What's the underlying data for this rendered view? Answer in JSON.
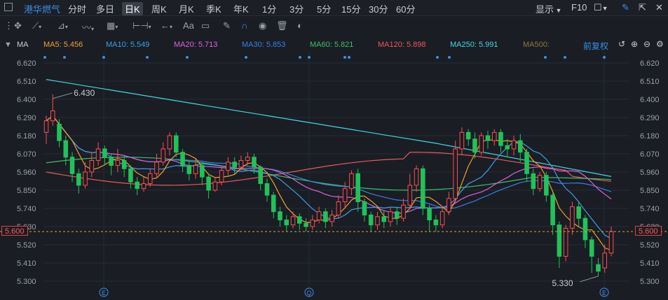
{
  "header": {
    "stock_name": "港华燃气",
    "timeframes": [
      "分时",
      "多日",
      "日K",
      "周K",
      "月K",
      "季K",
      "年K",
      "1分",
      "3分",
      "5分",
      "15分",
      "30分",
      "60分"
    ],
    "active_timeframe": "日K",
    "show_label": "显示",
    "f10_label": "F10"
  },
  "toolbar": {
    "font_label": "Aa"
  },
  "ma_bar": {
    "label": "MA",
    "items": [
      {
        "text": "MA5: 5.456",
        "color": "#f0a030"
      },
      {
        "text": "MA10: 5.549",
        "color": "#3aa0e8"
      },
      {
        "text": "MA20: 5.713",
        "color": "#e060e0"
      },
      {
        "text": "MA30: 5.853",
        "color": "#3a7ee6"
      },
      {
        "text": "MA60: 5.821",
        "color": "#3cc06a"
      },
      {
        "text": "MA120: 5.898",
        "color": "#e85a5a"
      },
      {
        "text": "MA250: 5.991",
        "color": "#40d8e0"
      },
      {
        "text": "MA500:",
        "color": "#8a7a40"
      }
    ],
    "adjust_label": "前复权"
  },
  "axis": {
    "ticks": [
      "6.620",
      "6.510",
      "6.400",
      "6.290",
      "6.180",
      "6.070",
      "5.960",
      "5.850",
      "5.740",
      "5.630",
      "5.520",
      "5.410",
      "5.300"
    ],
    "current_price": "5.600"
  },
  "annotations": {
    "high": "6.430",
    "low": "5.330"
  },
  "markers": {
    "e1": "E",
    "q": "Q",
    "e2": "E"
  },
  "colors": {
    "up": "#ff4d4f",
    "down": "#21c25a",
    "background": "#1a1d24",
    "accent": "#3a8ee6"
  },
  "chart_data": {
    "type": "candlestick",
    "y_range": [
      5.25,
      6.66
    ],
    "candles": [
      [
        6.2,
        6.27,
        6.13,
        6.3
      ],
      [
        6.27,
        6.33,
        6.24,
        6.43
      ],
      [
        6.25,
        6.15,
        6.11,
        6.28
      ],
      [
        6.15,
        6.05,
        6.0,
        6.18
      ],
      [
        6.05,
        5.95,
        5.9,
        6.08
      ],
      [
        5.95,
        5.88,
        5.83,
        5.98
      ],
      [
        5.88,
        5.96,
        5.86,
        6.02
      ],
      [
        5.96,
        6.03,
        5.93,
        6.08
      ],
      [
        6.03,
        6.1,
        6.0,
        6.14
      ],
      [
        6.1,
        6.05,
        6.0,
        6.12
      ],
      [
        6.05,
        6.0,
        5.94,
        6.07
      ],
      [
        6.0,
        6.03,
        5.96,
        6.1
      ],
      [
        6.03,
        5.98,
        5.93,
        6.06
      ],
      [
        5.98,
        5.9,
        5.86,
        6.0
      ],
      [
        5.9,
        5.86,
        5.82,
        5.93
      ],
      [
        5.86,
        5.89,
        5.84,
        5.93
      ],
      [
        5.89,
        5.95,
        5.87,
        5.98
      ],
      [
        5.95,
        6.02,
        5.93,
        6.07
      ],
      [
        6.02,
        6.1,
        6.0,
        6.14
      ],
      [
        6.1,
        6.18,
        6.06,
        6.2
      ],
      [
        6.18,
        6.08,
        6.05,
        6.2
      ],
      [
        6.08,
        6.0,
        5.96,
        6.1
      ],
      [
        6.0,
        5.95,
        5.91,
        6.03
      ],
      [
        5.95,
        6.0,
        5.92,
        6.04
      ],
      [
        6.0,
        5.93,
        5.88,
        6.02
      ],
      [
        5.93,
        5.85,
        5.8,
        5.95
      ],
      [
        5.85,
        5.9,
        5.84,
        5.93
      ],
      [
        5.9,
        5.97,
        5.88,
        6.0
      ],
      [
        5.97,
        6.02,
        5.94,
        6.05
      ],
      [
        6.02,
        5.99,
        5.95,
        6.05
      ],
      [
        5.99,
        6.03,
        5.97,
        6.06
      ],
      [
        6.03,
        6.05,
        6.0,
        6.08
      ],
      [
        6.05,
        5.99,
        5.95,
        6.07
      ],
      [
        5.99,
        5.89,
        5.85,
        6.0
      ],
      [
        5.89,
        5.82,
        5.78,
        5.92
      ],
      [
        5.82,
        5.72,
        5.68,
        5.84
      ],
      [
        5.72,
        5.67,
        5.63,
        5.75
      ],
      [
        5.67,
        5.64,
        5.6,
        5.7
      ],
      [
        5.64,
        5.69,
        5.62,
        5.72
      ],
      [
        5.69,
        5.65,
        5.61,
        5.71
      ],
      [
        5.65,
        5.63,
        5.6,
        5.68
      ],
      [
        5.63,
        5.67,
        5.61,
        5.7
      ],
      [
        5.67,
        5.72,
        5.65,
        5.75
      ],
      [
        5.72,
        5.66,
        5.62,
        5.74
      ],
      [
        5.66,
        5.7,
        5.63,
        5.73
      ],
      [
        5.7,
        5.78,
        5.68,
        5.82
      ],
      [
        5.78,
        5.86,
        5.75,
        5.9
      ],
      [
        5.86,
        5.95,
        5.82,
        5.97
      ],
      [
        5.95,
        5.78,
        5.72,
        5.98
      ],
      [
        5.78,
        5.7,
        5.66,
        5.8
      ],
      [
        5.7,
        5.64,
        5.6,
        5.72
      ],
      [
        5.64,
        5.69,
        5.61,
        5.72
      ],
      [
        5.69,
        5.66,
        5.62,
        5.73
      ],
      [
        5.66,
        5.72,
        5.63,
        5.75
      ],
      [
        5.72,
        5.68,
        5.64,
        5.75
      ],
      [
        5.68,
        5.76,
        5.66,
        5.8
      ],
      [
        5.76,
        5.88,
        5.74,
        5.95
      ],
      [
        5.88,
        5.98,
        5.84,
        6.0
      ],
      [
        5.98,
        5.74,
        5.7,
        6.0
      ],
      [
        5.74,
        5.67,
        5.6,
        5.76
      ],
      [
        5.67,
        5.64,
        5.6,
        5.7
      ],
      [
        5.64,
        5.72,
        5.62,
        5.75
      ],
      [
        5.72,
        5.8,
        5.7,
        5.84
      ],
      [
        5.8,
        6.1,
        5.78,
        6.15
      ],
      [
        6.1,
        6.2,
        6.06,
        6.23
      ],
      [
        6.2,
        6.16,
        6.12,
        6.22
      ],
      [
        6.16,
        6.08,
        6.04,
        6.2
      ],
      [
        6.08,
        6.18,
        6.06,
        6.2
      ],
      [
        6.18,
        6.15,
        6.1,
        6.21
      ],
      [
        6.15,
        6.2,
        6.12,
        6.22
      ],
      [
        6.2,
        6.12,
        6.08,
        6.22
      ],
      [
        6.12,
        6.1,
        6.05,
        6.16
      ],
      [
        6.1,
        6.15,
        6.06,
        6.18
      ],
      [
        6.15,
        6.08,
        6.02,
        6.19
      ],
      [
        6.08,
        5.95,
        5.9,
        6.1
      ],
      [
        5.95,
        5.86,
        5.82,
        5.98
      ],
      [
        5.86,
        5.94,
        5.84,
        5.96
      ],
      [
        5.94,
        5.82,
        5.78,
        5.96
      ],
      [
        5.82,
        5.64,
        5.58,
        5.84
      ],
      [
        5.64,
        5.45,
        5.38,
        5.66
      ],
      [
        5.45,
        5.62,
        5.42,
        5.64
      ],
      [
        5.62,
        5.75,
        5.58,
        5.78
      ],
      [
        5.75,
        5.68,
        5.63,
        5.78
      ],
      [
        5.68,
        5.55,
        5.5,
        5.7
      ],
      [
        5.55,
        5.45,
        5.35,
        5.57
      ],
      [
        5.4,
        5.36,
        5.33,
        5.44
      ],
      [
        5.38,
        5.47,
        5.35,
        5.52
      ],
      [
        5.47,
        5.6,
        5.45,
        5.63
      ]
    ],
    "ma_lines": [
      "MA5",
      "MA10",
      "MA20",
      "MA30",
      "MA60",
      "MA120",
      "MA250"
    ]
  }
}
